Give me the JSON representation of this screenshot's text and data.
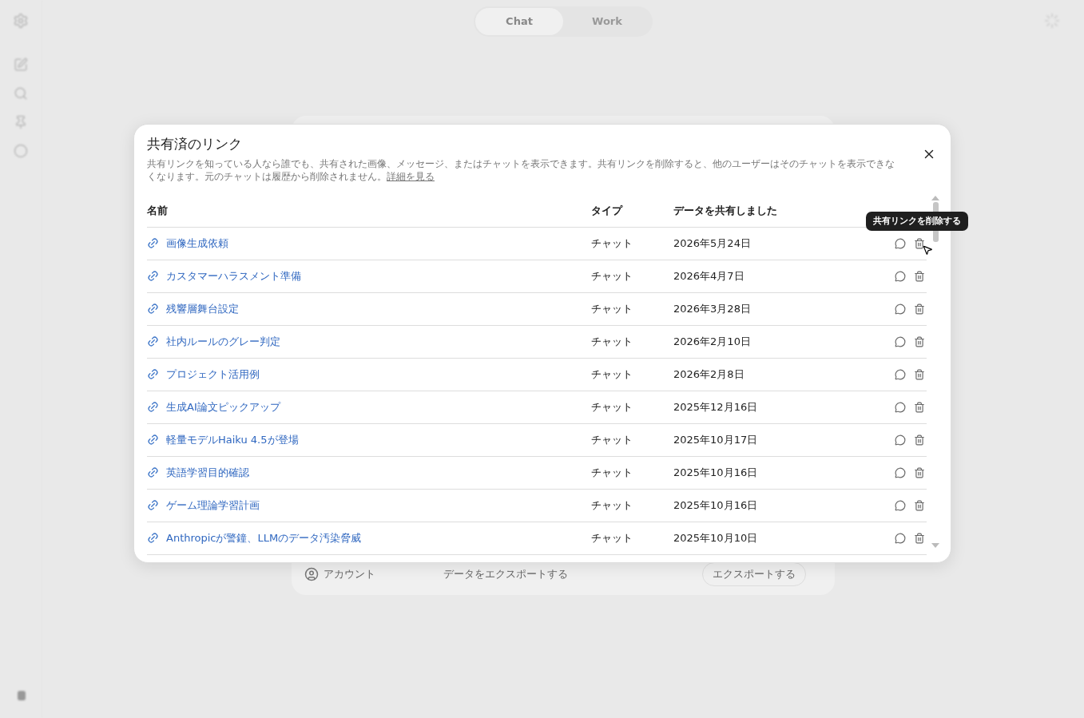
{
  "background": {
    "tabs": [
      {
        "label": "Chat",
        "selected": true
      },
      {
        "label": "Work",
        "selected": false
      }
    ],
    "settings": {
      "nav_item": "アカウント",
      "row_label": "データをエクスポートする",
      "button": "エクスポートする"
    }
  },
  "dialog": {
    "title": "共有済のリンク",
    "description": "共有リンクを知っている人なら誰でも、共有された画像、メッセージ、またはチャットを表示できます。共有リンクを削除すると、他のユーザーはそのチャットを表示できなくなります。元のチャットは履歴から削除されません。",
    "learn_more": "詳細を見る",
    "columns": [
      "名前",
      "タイプ",
      "データを共有しました"
    ],
    "rows": [
      {
        "name": "画像生成依頼",
        "type": "チャット",
        "date": "2026年5月24日"
      },
      {
        "name": "カスタマーハラスメント準備",
        "type": "チャット",
        "date": "2026年4月7日"
      },
      {
        "name": "残響層舞台設定",
        "type": "チャット",
        "date": "2026年3月28日"
      },
      {
        "name": "社内ルールのグレー判定",
        "type": "チャット",
        "date": "2026年2月10日"
      },
      {
        "name": "プロジェクト活用例",
        "type": "チャット",
        "date": "2026年2月8日"
      },
      {
        "name": "生成AI論文ピックアップ",
        "type": "チャット",
        "date": "2025年12月16日"
      },
      {
        "name": "軽量モデルHaiku 4.5が登場",
        "type": "チャット",
        "date": "2025年10月17日"
      },
      {
        "name": "英語学習目的確認",
        "type": "チャット",
        "date": "2025年10月16日"
      },
      {
        "name": "ゲーム理論学習計画",
        "type": "チャット",
        "date": "2025年10月16日"
      },
      {
        "name": "Anthropicが警鐘、LLMのデータ汚染脅威",
        "type": "チャット",
        "date": "2025年10月10日"
      }
    ],
    "tooltip": "共有リンクを削除する"
  }
}
